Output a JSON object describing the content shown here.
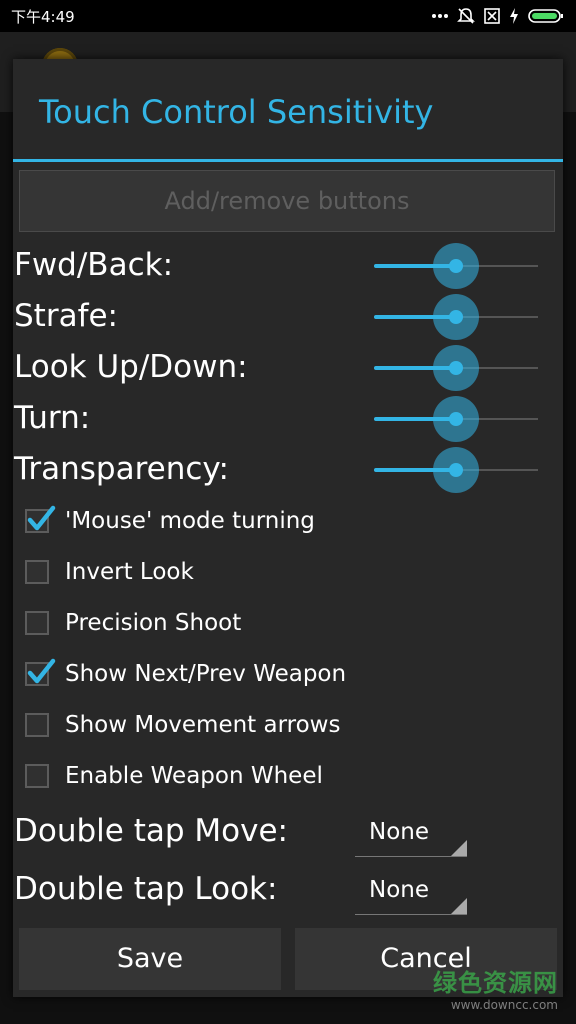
{
  "status_bar": {
    "time": "下午4:49",
    "icons": [
      "more-dots-icon",
      "muted-bell-icon",
      "no-sim-icon",
      "charging-icon",
      "battery-icon"
    ]
  },
  "dialog": {
    "title": "Touch Control Sensitivity",
    "add_remove_label": "Add/remove buttons",
    "sliders": [
      {
        "label": "Fwd/Back:",
        "value_percent": 50
      },
      {
        "label": "Strafe:",
        "value_percent": 50
      },
      {
        "label": "Look Up/Down:",
        "value_percent": 50
      },
      {
        "label": "Turn:",
        "value_percent": 50
      },
      {
        "label": "Transparency:",
        "value_percent": 50
      }
    ],
    "checkboxes": [
      {
        "label": "'Mouse' mode turning",
        "checked": true
      },
      {
        "label": "Invert Look",
        "checked": false
      },
      {
        "label": "Precision Shoot",
        "checked": false
      },
      {
        "label": "Show Next/Prev Weapon",
        "checked": true
      },
      {
        "label": "Show Movement arrows",
        "checked": false
      },
      {
        "label": "Enable Weapon Wheel",
        "checked": false
      }
    ],
    "spinners": [
      {
        "label": "Double tap Move:",
        "value": "None"
      },
      {
        "label": "Double tap Look:",
        "value": "None"
      }
    ],
    "save_label": "Save",
    "cancel_label": "Cancel"
  },
  "watermark": {
    "text": "绿色资源网",
    "url": "www.downcc.com"
  },
  "colors": {
    "accent": "#33b5e5",
    "dialog_bg": "#282828"
  }
}
